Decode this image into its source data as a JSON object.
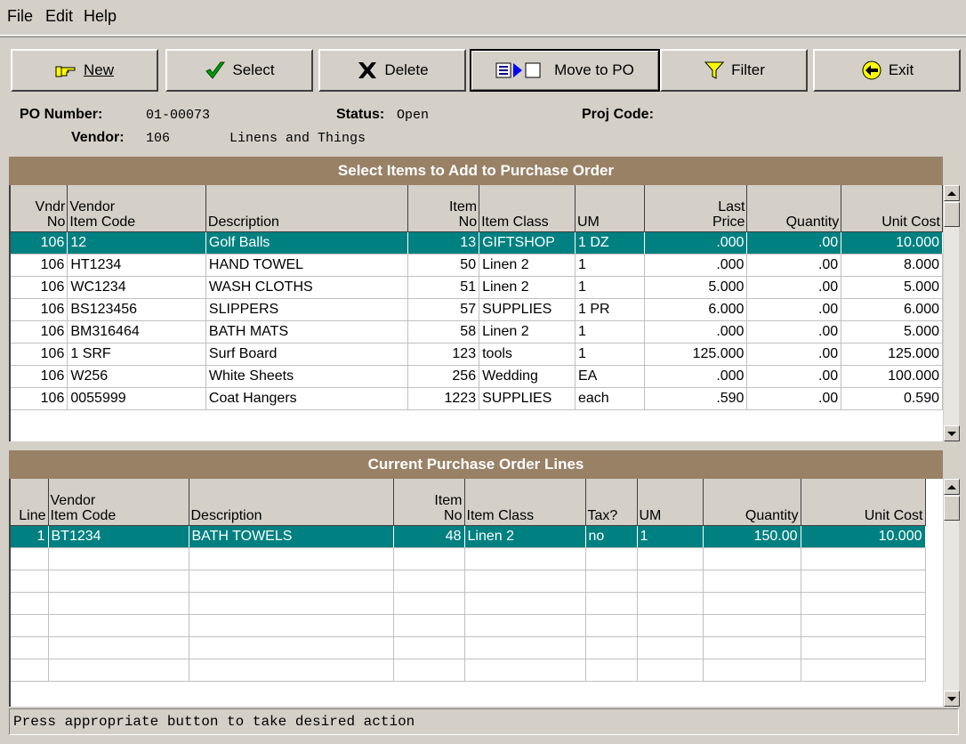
{
  "menu": {
    "file": "File",
    "edit": "Edit",
    "help": "Help"
  },
  "toolbar": {
    "new": "New",
    "select": "Select",
    "delete": "Delete",
    "move": "Move to PO",
    "filter": "Filter",
    "exit": "Exit"
  },
  "po": {
    "number_label": "PO Number:",
    "number": "01-00073",
    "status_label": "Status:",
    "status": "Open",
    "proj_label": "Proj Code:",
    "proj": "",
    "vendor_label": "Vendor:",
    "vendor_no": "106",
    "vendor_name": "Linens and Things"
  },
  "select_items": {
    "title": "Select Items to Add to Purchase Order",
    "headers": {
      "vndr_no_1": "Vndr",
      "vndr_no_2": "No",
      "vic_1": "Vendor",
      "vic_2": "Item Code",
      "desc": "Description",
      "item_no_1": "Item",
      "item_no_2": "No",
      "item_class": "Item Class",
      "um": "UM",
      "last_price_1": "Last",
      "last_price_2": "Price",
      "quantity": "Quantity",
      "unit_cost": "Unit Cost"
    },
    "rows": [
      {
        "vndr": "106",
        "code": "12",
        "desc": "Golf Balls",
        "item": "13",
        "cls": "GIFTSHOP",
        "um": "1 DZ",
        "last": ".000",
        "qty": ".00",
        "cost": "10.000"
      },
      {
        "vndr": "106",
        "code": "HT1234",
        "desc": "HAND TOWEL",
        "item": "50",
        "cls": "Linen 2",
        "um": "1",
        "last": ".000",
        "qty": ".00",
        "cost": "8.000"
      },
      {
        "vndr": "106",
        "code": "WC1234",
        "desc": "WASH CLOTHS",
        "item": "51",
        "cls": "Linen 2",
        "um": "1",
        "last": "5.000",
        "qty": ".00",
        "cost": "5.000"
      },
      {
        "vndr": "106",
        "code": "BS123456",
        "desc": "SLIPPERS",
        "item": "57",
        "cls": "SUPPLIES",
        "um": "1 PR",
        "last": "6.000",
        "qty": ".00",
        "cost": "6.000"
      },
      {
        "vndr": "106",
        "code": "BM316464",
        "desc": "BATH MATS",
        "item": "58",
        "cls": "Linen 2",
        "um": "1",
        "last": ".000",
        "qty": ".00",
        "cost": "5.000"
      },
      {
        "vndr": "106",
        "code": "1 SRF",
        "desc": "Surf Board",
        "item": "123",
        "cls": "tools",
        "um": "1",
        "last": "125.000",
        "qty": ".00",
        "cost": "125.000"
      },
      {
        "vndr": "106",
        "code": "W256",
        "desc": "White Sheets",
        "item": "256",
        "cls": "Wedding",
        "um": "EA",
        "last": ".000",
        "qty": ".00",
        "cost": "100.000"
      },
      {
        "vndr": "106",
        "code": "0055999",
        "desc": "Coat Hangers",
        "item": "1223",
        "cls": "SUPPLIES",
        "um": "each",
        "last": ".590",
        "qty": ".00",
        "cost": "0.590"
      }
    ]
  },
  "po_lines": {
    "title": "Current Purchase Order Lines",
    "headers": {
      "line": "Line",
      "vic_1": "Vendor",
      "vic_2": "Item Code",
      "desc": "Description",
      "item_no_1": "Item",
      "item_no_2": "No",
      "item_class": "Item Class",
      "tax": "Tax?",
      "um": "UM",
      "quantity": "Quantity",
      "unit_cost": "Unit Cost"
    },
    "rows": [
      {
        "line": "1",
        "code": "BT1234",
        "desc": "BATH TOWELS",
        "item": "48",
        "cls": "Linen 2",
        "tax": "no",
        "um": "1",
        "qty": "150.00",
        "cost": "10.000"
      }
    ]
  },
  "status_message": "Press appropriate button to take desired action",
  "colors": {
    "selection": "#008080",
    "section_header": "#998166",
    "window": "#d4d0c8"
  }
}
